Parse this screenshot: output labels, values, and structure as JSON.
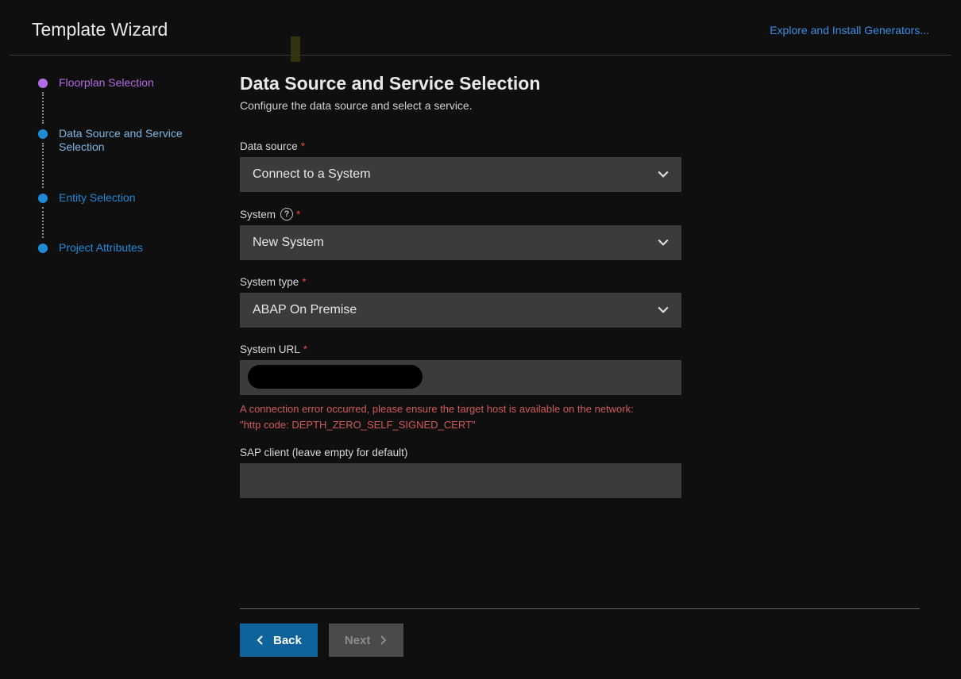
{
  "header": {
    "title": "Template Wizard",
    "explore_link": "Explore and Install Generators..."
  },
  "steps": [
    {
      "label": "Floorplan Selection",
      "state": "done"
    },
    {
      "label": "Data Source and Service Selection",
      "state": "current"
    },
    {
      "label": "Entity Selection",
      "state": "todo"
    },
    {
      "label": "Project Attributes",
      "state": "todo"
    }
  ],
  "main": {
    "heading": "Data Source and Service Selection",
    "subtitle": "Configure the data source and select a service."
  },
  "fields": {
    "data_source": {
      "label": "Data source",
      "required": true,
      "value": "Connect to a System"
    },
    "system": {
      "label": "System",
      "required": true,
      "help": true,
      "value": "New System"
    },
    "system_type": {
      "label": "System type",
      "required": true,
      "value": "ABAP On Premise"
    },
    "system_url": {
      "label": "System URL",
      "required": true,
      "value": ""
    },
    "sap_client": {
      "label": "SAP client (leave empty for default)",
      "required": false,
      "value": ""
    }
  },
  "error": {
    "line1": "A connection error occurred, please ensure the target host is available on the network:",
    "line2": "\"http code: DEPTH_ZERO_SELF_SIGNED_CERT\""
  },
  "footer": {
    "back": "Back",
    "next": "Next"
  },
  "colors": {
    "accent_blue": "#0e639c",
    "link_blue": "#3b8de2",
    "step_blue": "#1f8ad6",
    "step_purple": "#b36be6",
    "error_red": "#d15a5a"
  }
}
